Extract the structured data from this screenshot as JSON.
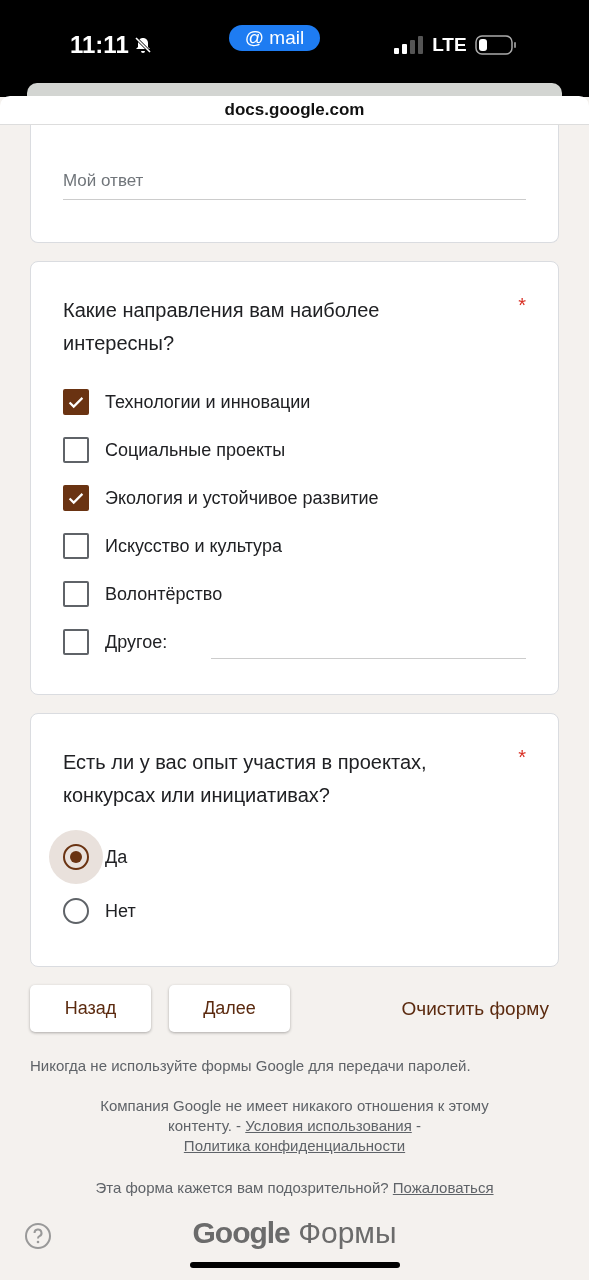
{
  "status_bar": {
    "time": "11:11",
    "pill": "@ mail",
    "network": "LTE"
  },
  "browser": {
    "url": "docs.google.com"
  },
  "questions": [
    {
      "kind": "text",
      "placeholder": "Мой ответ"
    },
    {
      "kind": "checkbox",
      "title": "Какие направления вам наиболее интересны?",
      "required_mark": "*",
      "options": [
        {
          "kind": "option",
          "label": "Технологии и инновации",
          "checked": true
        },
        {
          "kind": "option",
          "label": "Социальные проекты",
          "checked": false
        },
        {
          "kind": "option",
          "label": "Экология и устойчивое развитие",
          "checked": true
        },
        {
          "kind": "option",
          "label": "Искусство и культура",
          "checked": false
        },
        {
          "kind": "option",
          "label": "Волонтёрство",
          "checked": false
        },
        {
          "kind": "other",
          "label": "Другое:",
          "checked": false
        }
      ]
    },
    {
      "kind": "radio",
      "title": "Есть ли у вас опыт участия в проектах, конкурсах или инициативах?",
      "required_mark": "*",
      "options": [
        {
          "label": "Да",
          "selected": true
        },
        {
          "label": "Нет",
          "selected": false
        }
      ]
    }
  ],
  "buttons": {
    "back": "Назад",
    "next": "Далее",
    "clear": "Очистить форму"
  },
  "footer": {
    "warning": "Никогда не используйте формы Google для передачи паролей.",
    "disclaimer": [
      {
        "kind": "text",
        "text": "Компания Google не имеет никакого отношения к этому контенту. - "
      },
      {
        "kind": "link",
        "text": "Условия использования"
      },
      {
        "kind": "text",
        "text": " - "
      },
      {
        "kind": "link",
        "text": "Политика конфиденциальности"
      }
    ],
    "report": [
      {
        "kind": "text",
        "text": "Эта форма кажется вам подозрительной? "
      },
      {
        "kind": "link",
        "text": "Пожаловаться"
      }
    ]
  },
  "logo": {
    "brand": "Google",
    "product": "Формы"
  }
}
